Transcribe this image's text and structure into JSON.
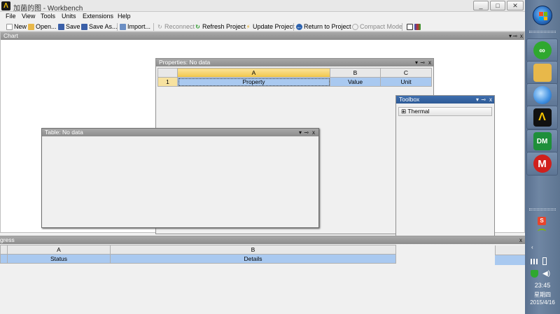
{
  "window": {
    "title": "加菌的图 - Workbench",
    "app_logo_letter": "Λ",
    "controls": {
      "minimize": "_",
      "maximize": "□",
      "close": "✕"
    }
  },
  "menu": [
    "File",
    "View",
    "Tools",
    "Units",
    "Extensions",
    "Help"
  ],
  "toolbar": {
    "new": "New",
    "open": "Open...",
    "save": "Save",
    "save_as": "Save As...",
    "import": "Import...",
    "reconnect": "Reconnect",
    "refresh": "Refresh Project",
    "update": "Update Project",
    "return": "Return to Project",
    "compact": "Compact Mode"
  },
  "chart": {
    "title": "Chart"
  },
  "pane_controls": {
    "dropdown": "▾",
    "pin": "⊸",
    "close": "x"
  },
  "properties": {
    "title": "Properties: No data",
    "columns": [
      "A",
      "B",
      "C"
    ],
    "row_number": "1",
    "row": [
      "Property",
      "Value",
      "Unit"
    ]
  },
  "toolbox": {
    "title": "Toolbox",
    "items": [
      {
        "expander": "⊞",
        "label": "Thermal"
      }
    ]
  },
  "table": {
    "title": "Table: No data"
  },
  "progress": {
    "title": "gress",
    "columns": [
      "A",
      "B"
    ],
    "row": [
      "Status",
      "Details"
    ]
  },
  "taskbar": {
    "clock_time": "23:45",
    "clock_day": "星期四",
    "clock_date": "2015/4/16",
    "apps": [
      {
        "name": "app-green-icon",
        "label": "∞",
        "color": "#2fa82f"
      },
      {
        "name": "folder-icon",
        "label": "",
        "color": "#e8b84a"
      },
      {
        "name": "globe-icon",
        "label": "",
        "color": "#3f8fe0"
      },
      {
        "name": "ansys-icon",
        "label": "Λ",
        "color": "#111111"
      },
      {
        "name": "designmodeler-icon",
        "label": "DM",
        "color": "#1e8f3a"
      },
      {
        "name": "mechanical-icon",
        "label": "M",
        "color": "#d0201c"
      }
    ],
    "tray": {
      "s_icon": "S",
      "chevron": "‹"
    }
  }
}
